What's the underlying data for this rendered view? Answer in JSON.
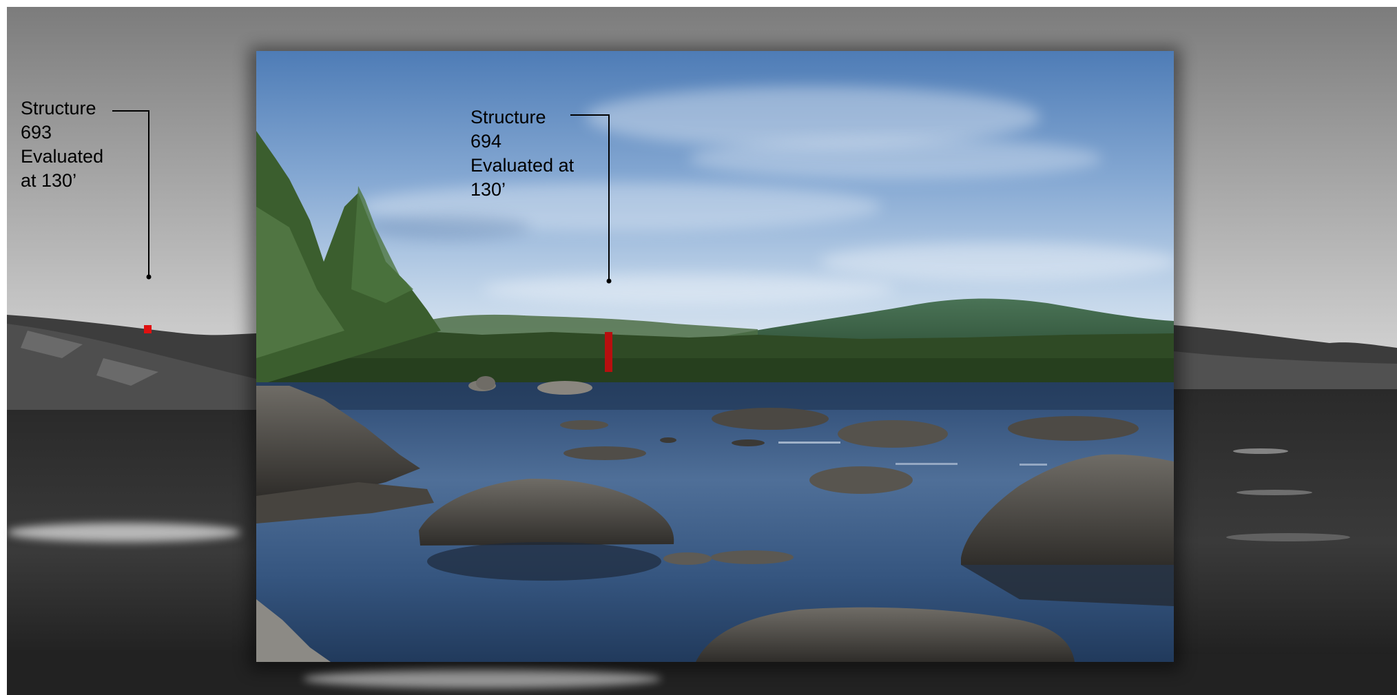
{
  "callouts": [
    {
      "structure": "693",
      "lines": [
        "Structure",
        "693",
        "Evaluated",
        "at 130’"
      ],
      "marker_color": "#e01010"
    },
    {
      "structure": "694",
      "lines": [
        "Structure",
        "694",
        "Evaluated at",
        "130’"
      ],
      "marker_color": "#b80f0f"
    }
  ],
  "colors": {
    "sky_gray_top": "#7e7e7e",
    "sky_gray_bottom": "#f2f2f2",
    "sky_blue_top": "#4f7fb9",
    "sky_blue_horizon": "#c9dbec",
    "water_blue": "#35557f",
    "forest_green": "#2f4a25",
    "mountain_green": "#3f6a4c",
    "leader_line": "#000000"
  }
}
